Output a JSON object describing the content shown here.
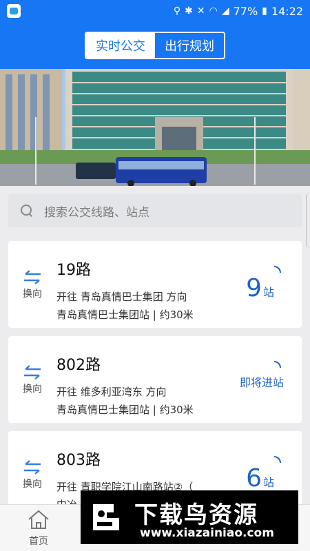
{
  "status_bar": {
    "battery": "77%",
    "time": "14:22",
    "icons": [
      "location-icon",
      "bluetooth-icon",
      "mute-icon",
      "wifi-icon",
      "signal-icon",
      "battery-icon"
    ]
  },
  "header": {
    "tabs": [
      {
        "label": "实时公交",
        "active": true
      },
      {
        "label": "出行规划",
        "active": false
      }
    ]
  },
  "search": {
    "placeholder": "搜索公交线路、站点"
  },
  "routes": [
    {
      "name": "19路",
      "direction": "开往 青岛真情巴士集团 方向",
      "station": "青岛真情巴士集团站 | 约30米",
      "stops": "9",
      "stops_unit": "站",
      "swap_label": "换向"
    },
    {
      "name": "802路",
      "direction": "开往 维多利亚湾东 方向",
      "station": "青岛真情巴士集团站 | 约30米",
      "arriving": "即将进站",
      "swap_label": "换向"
    },
    {
      "name": "803路",
      "direction": "开往 青职学院江山南路站②（",
      "station": "中冶",
      "stops": "6",
      "stops_unit": "站",
      "swap_label": "换向"
    }
  ],
  "tabbar": {
    "home_label": "首页"
  },
  "watermark": {
    "title": "下载鸟资源",
    "url": "www.xiazainiao.com"
  },
  "colors": {
    "brand_blue": "#1676f3",
    "stop_blue": "#1f63c9"
  }
}
